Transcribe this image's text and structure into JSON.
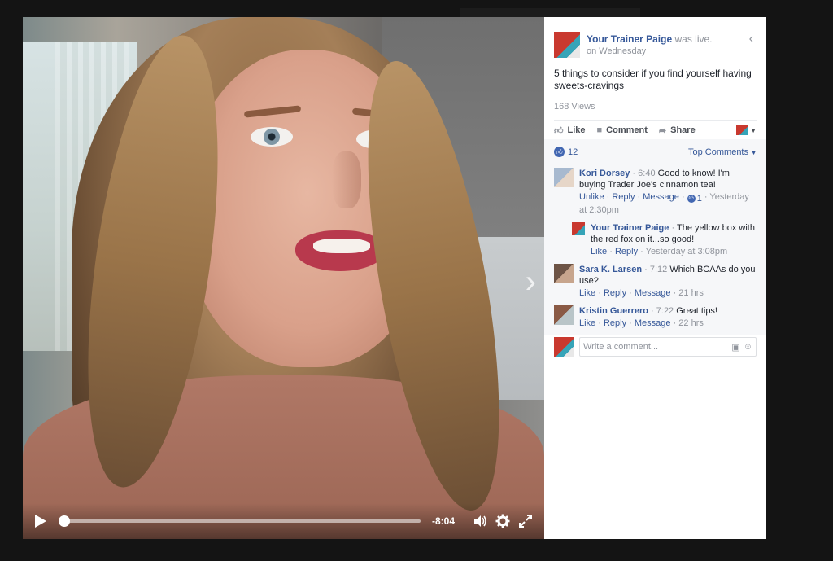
{
  "post": {
    "author": "Your Trainer Paige",
    "action": "was live.",
    "when": "on Wednesday",
    "text": "5 things to consider if you find yourself having sweets-cravings",
    "views": "168 Views"
  },
  "actions": {
    "like": "Like",
    "comment": "Comment",
    "share": "Share"
  },
  "comments_summary": {
    "like_count": "12",
    "sort": "Top Comments"
  },
  "comments": [
    {
      "name": "Kori Dorsey",
      "timestamp": "6:40",
      "text": "Good to know! I'm buying Trader Joe's cinnamon tea!",
      "like": "Unlike",
      "reply": "Reply",
      "message": "Message",
      "likes": "1",
      "time": "Yesterday at 2:30pm"
    },
    {
      "name": "Your Trainer Paige",
      "text": "The yellow box with the red fox on it...so good!",
      "like": "Like",
      "reply": "Reply",
      "time": "Yesterday at 3:08pm"
    },
    {
      "name": "Sara K. Larsen",
      "timestamp": "7:12",
      "text": "Which BCAAs do you use?",
      "like": "Like",
      "reply": "Reply",
      "message": "Message",
      "time": "21 hrs"
    },
    {
      "name": "Kristin Guerrero",
      "timestamp": "7:22",
      "text": "Great tips!",
      "like": "Like",
      "reply": "Reply",
      "message": "Message",
      "time": "22 hrs"
    }
  ],
  "composer": {
    "placeholder": "Write a comment..."
  },
  "player": {
    "time_remaining": "-8:04",
    "progress": 0.015
  },
  "colors": {
    "link": "#365899",
    "like_blue": "#4267b2",
    "meta_gray": "#90949c"
  }
}
